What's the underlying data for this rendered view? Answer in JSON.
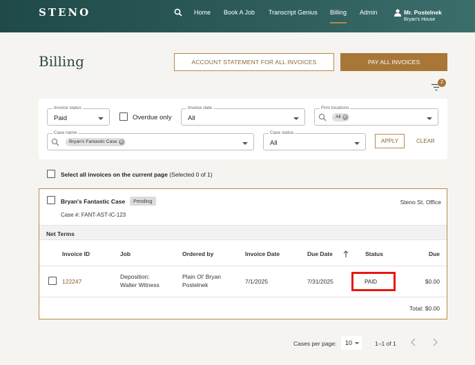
{
  "brand": {
    "logo": "STENO"
  },
  "nav": {
    "items": [
      {
        "label": "Home"
      },
      {
        "label": "Book A Job"
      },
      {
        "label": "Transcript Genius"
      },
      {
        "label": "Billing",
        "active": true
      },
      {
        "label": "Admin"
      }
    ],
    "user": {
      "name": "Mr. Postelnek",
      "house": "Bryan's House"
    }
  },
  "page": {
    "title": "Billing",
    "statement_button": "ACCOUNT STATEMENT FOR ALL INVOICES",
    "pay_button": "PAY ALL INVOICES",
    "filter_count": "2"
  },
  "filters": {
    "invoice_status": {
      "label": "Invoice status",
      "value": "Paid"
    },
    "overdue_only": {
      "label": "Overdue only",
      "checked": false
    },
    "invoice_date": {
      "label": "Invoice date",
      "value": "All"
    },
    "firm_locations": {
      "label": "Firm locations",
      "chip": "All"
    },
    "case_name": {
      "label": "Case name",
      "chip": "Bryan's Fantastic Case"
    },
    "case_status": {
      "label": "Case status",
      "value": "All"
    },
    "apply": "APPLY",
    "clear": "CLEAR"
  },
  "select_all": {
    "label": "Select all invoices on the current page",
    "selected": "(Selected 0 of 1)"
  },
  "case": {
    "name": "Bryan's Fantastic Case",
    "badge": "Pending",
    "office": "Steno St. Office",
    "case_number": "Case #: FANT-AST-IC-123",
    "terms": "Net Terms",
    "columns": {
      "invoice_id": "Invoice ID",
      "job": "Job",
      "ordered_by": "Ordered by",
      "invoice_date": "Invoice Date",
      "due_date": "Due Date",
      "status": "Status",
      "due": "Due"
    },
    "invoice": {
      "id": "122247",
      "job_line1": "Deposition:",
      "job_line2": "Walter Witness",
      "ordered_line1": "Plain Ol' Bryan",
      "ordered_line2": "Postelnek",
      "invoice_date": "7/1/2025",
      "due_date": "7/31/2025",
      "status": "PAID",
      "due": "$0.00"
    },
    "total": "Total: $0.00"
  },
  "pagination": {
    "label": "Cases per page:",
    "per_page": "10",
    "range": "1–1 of 1"
  },
  "colors": {
    "accent": "#a87636",
    "header": "#2d5c5a",
    "highlight": "#e8170f"
  }
}
